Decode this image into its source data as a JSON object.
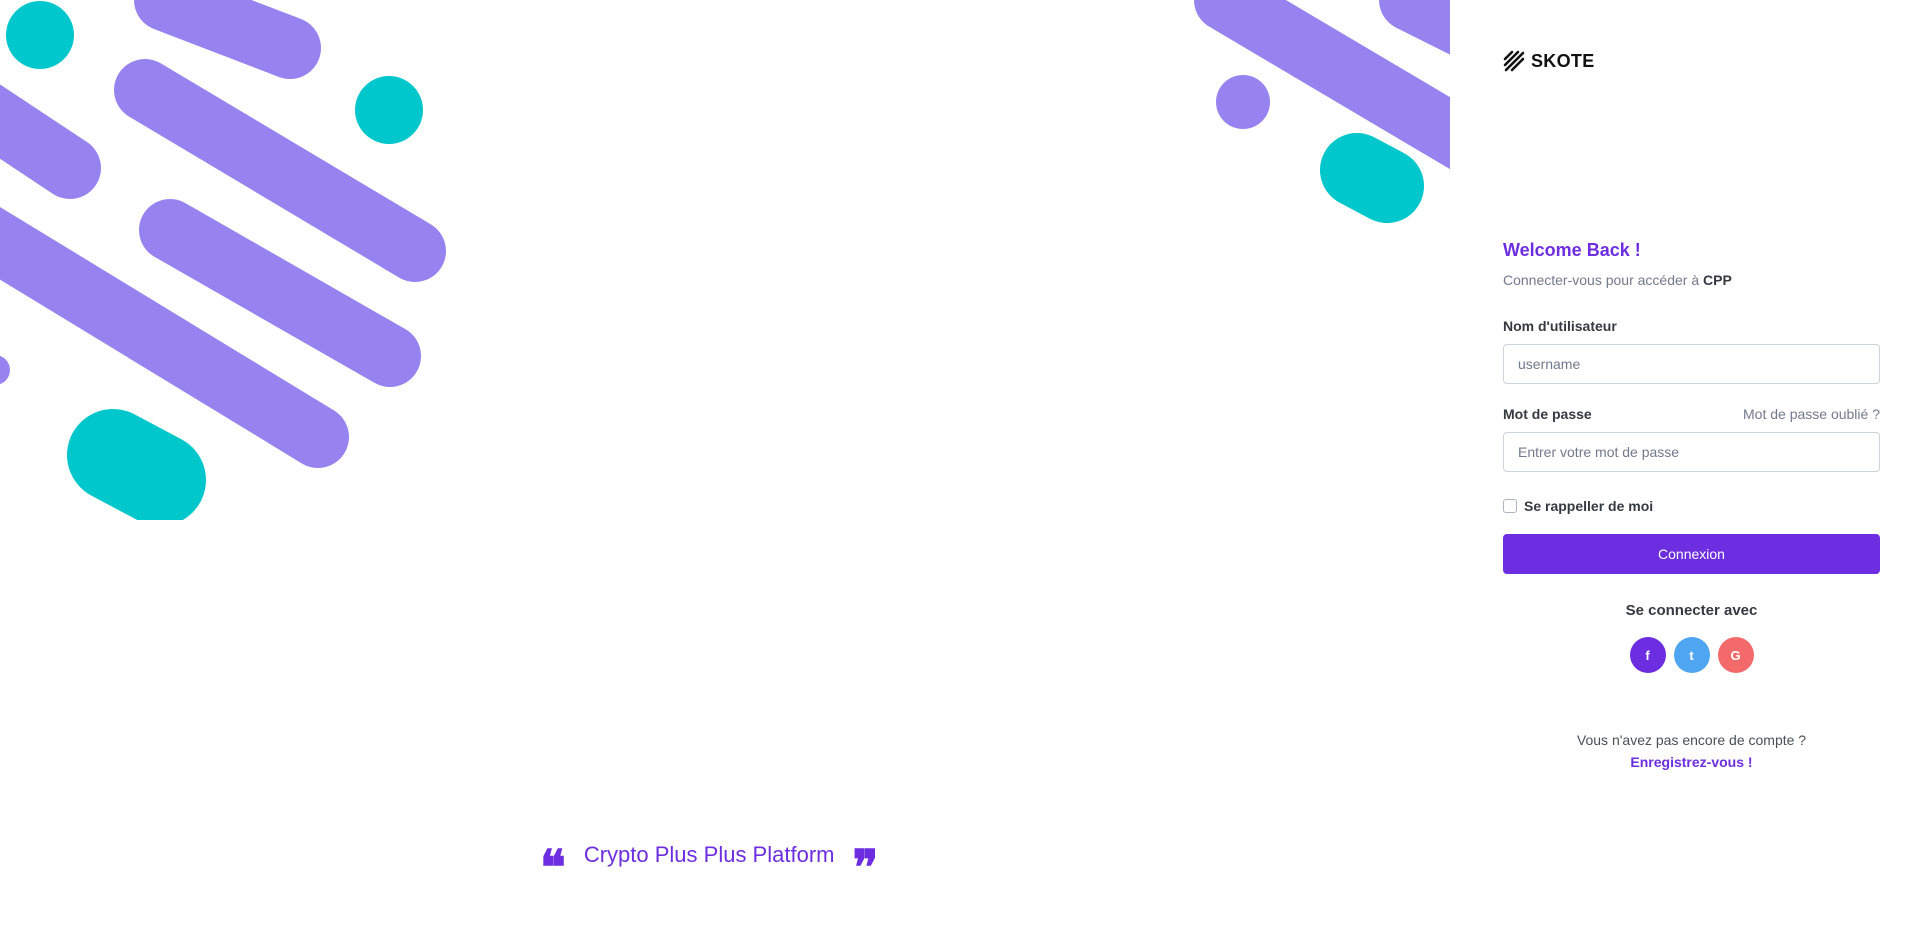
{
  "brand": {
    "logo_text": "SKOTE",
    "accent_color": "#6c2ee0",
    "decor_purple": "#9783f0",
    "decor_teal": "#00c7cc"
  },
  "quote": {
    "text": "Crypto Plus Plus Platform",
    "open_icon": "quote-left-icon",
    "close_icon": "quote-right-icon"
  },
  "login": {
    "title": "Welcome Back !",
    "subtitle_prefix": "Connecter-vous pour accéder à ",
    "subtitle_brand": "CPP",
    "username": {
      "label": "Nom d'utilisateur",
      "placeholder": "username",
      "value": ""
    },
    "password": {
      "label": "Mot de passe",
      "forgot_link": "Mot de passe oublié ?",
      "placeholder": "Entrer votre mot de passe",
      "value": ""
    },
    "remember_label": "Se rappeller de moi",
    "remember_checked": false,
    "submit_label": "Connexion"
  },
  "social": {
    "title": "Se connecter avec",
    "buttons": [
      {
        "name": "facebook",
        "icon": "facebook-icon",
        "glyph": "f",
        "color": "#6c2ee0"
      },
      {
        "name": "twitter",
        "icon": "twitter-icon",
        "glyph": "t",
        "color": "#50a5f1"
      },
      {
        "name": "google",
        "icon": "google-icon",
        "glyph": "G",
        "color": "#f46a6a"
      }
    ]
  },
  "signup": {
    "prompt": "Vous n'avez pas encore de compte ?",
    "link": "Enregistrez-vous !"
  }
}
